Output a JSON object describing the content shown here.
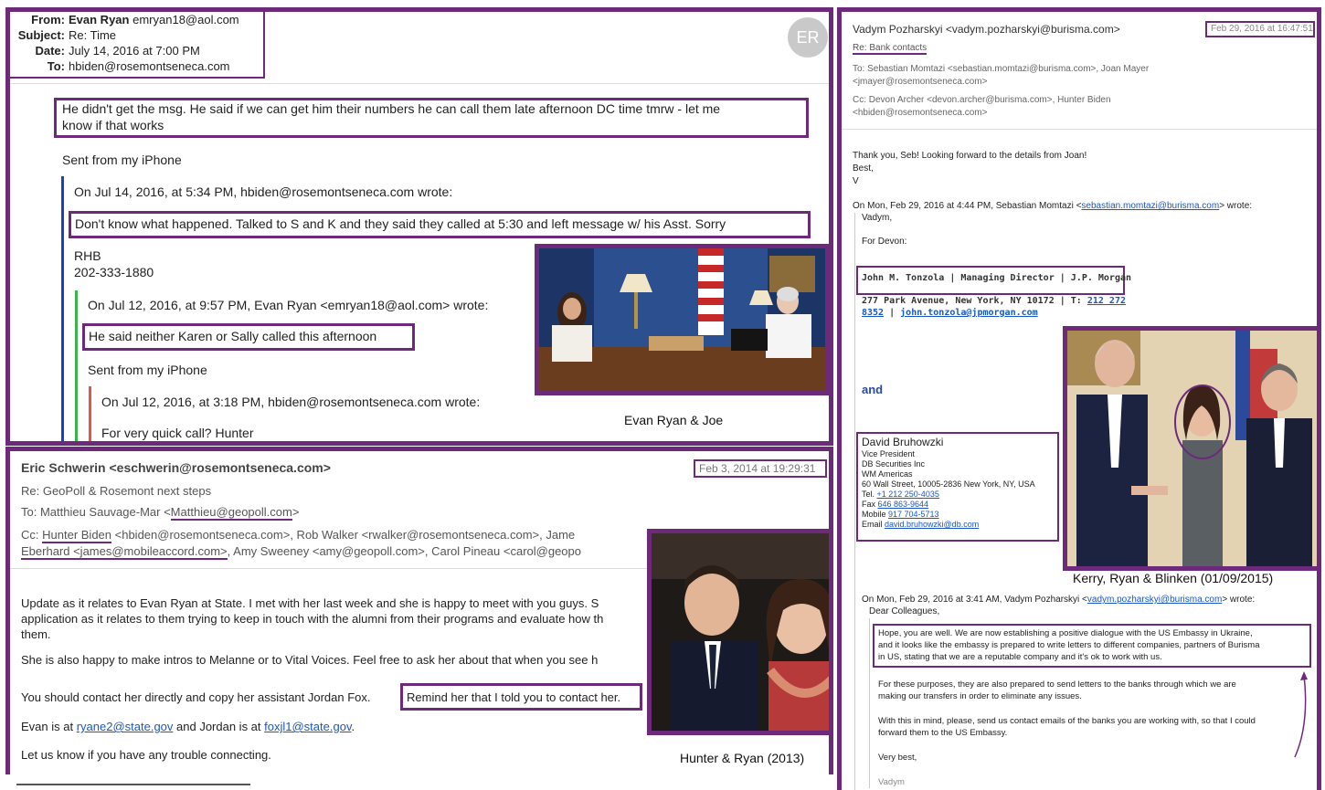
{
  "email1": {
    "header": {
      "from_label": "From:",
      "from_name": "Evan Ryan",
      "from_email": "emryan18@aol.com",
      "subject_label": "Subject:",
      "subject": "Re: Time",
      "date_label": "Date:",
      "date": "July 14, 2016 at 7:00 PM",
      "to_label": "To:",
      "to": "hbiden@rosemontseneca.com",
      "avatar": "ER"
    },
    "msg1": "He didn't get the msg.  He said if we can get him their numbers he can call them late afternoon DC time tmrw - let me",
    "msg1b": "know if that works",
    "sent1": "Sent from my iPhone",
    "quote1_head": "On Jul 14, 2016, at 5:34 PM, hbiden@rosemontseneca.com wrote:",
    "quote1_text": "Don't know what happened. Talked to S and K and they said they called at 5:30 and left message w/ his Asst. Sorry",
    "sig_name": "RHB",
    "sig_phone": "202-333-1880",
    "quote2_head": "On Jul 12, 2016, at 9:57 PM, Evan Ryan <emryan18@aol.com> wrote:",
    "quote2_text": "He said neither Karen or Sally called this afternoon",
    "sent2": "Sent from my iPhone",
    "quote3_head": "On Jul 12, 2016, at 3:18 PM, hbiden@rosemontseneca.com wrote:",
    "quote3_text": "For very quick call? Hunter",
    "photo_caption": "Evan Ryan & Joe"
  },
  "email2": {
    "from": "Eric Schwerin <eschwerin@rosemontseneca.com>",
    "timestamp": "Feb 3, 2014 at 19:29:31",
    "subject": "Re: GeoPoll & Rosemont next steps",
    "to_prefix": "To: Matthieu Sauvage-Mar <",
    "to_email": "Matthieu@geopoll.com",
    "to_suffix": ">",
    "cc_line1_a": "Cc: ",
    "cc_hunter": "Hunter Biden",
    "cc_line1_b": " <hbiden@rosemontseneca.com>, Rob Walker <rwalker@rosemontseneca.com>, Jame",
    "cc_line2_a": "Eberhard <james@mobileaccord.com>",
    "cc_line2_b": ", Amy Sweeney <amy@geopoll.com>, Carol Pineau <carol@geopo",
    "p1a": "Update as it relates to Evan Ryan at State.  I met with her last week and she is happy to meet with you guys.  S",
    "p1b": "application as it relates to them trying to keep in touch with the alumni from their programs and evaluate how th",
    "p1c": "them.",
    "p2": "She is also happy to make intros to Melanne or to Vital Voices.  Feel free to ask her about that when you see h",
    "p3a": "You should contact her directly and copy her assistant Jordan Fox.",
    "p3b": "Remind her that I told you to contact her.",
    "p4_a": "Evan is at ",
    "p4_email1": "ryane2@state.gov",
    "p4_b": " and Jordan is at ",
    "p4_email2": "foxjl1@state.gov",
    "p4_c": ".",
    "p5": "Let us know if you have any trouble connecting.",
    "photo_caption": "Hunter & Ryan (2013)"
  },
  "email3": {
    "from": "Vadym Pozharskyi <vadym.pozharskyi@burisma.com>",
    "timestamp": "Feb 29, 2016 at 16:47:51",
    "subject": "Re: Bank contacts",
    "to_line1": "To: Sebastian Momtazi <sebastian.momtazi@burisma.com>, Joan Mayer",
    "to_line2": "<jmayer@rosemontseneca.com>",
    "cc_line1": "Cc: Devon Archer <devon.archer@burisma.com>, Hunter Biden",
    "cc_line2": "<hbiden@rosemontseneca.com>",
    "thanks": "Thank you, Seb! Looking forward to the details from Joan!",
    "best": "Best,",
    "v": "V",
    "on1_a": "On Mon, Feb 29, 2016 at 4:44 PM, Sebastian Momtazi <",
    "on1_link": "sebastian.momtazi@burisma.com",
    "on1_b": "> wrote:",
    "vadym_salute": "Vadym,",
    "for_devon": "For Devon:",
    "tonzola_line1": "John M. Tonzola | Managing Director | J.P. Morgan",
    "tonzola_line2a": "277 Park Avenue, New York, NY 10172 | T: ",
    "tonzola_phone_a": "212 272",
    "tonzola_phone_b": "8352",
    "tonzola_sep": " | ",
    "tonzola_email": "john.tonzola@jpmorgan.com",
    "and_text": "and",
    "bru_name": "David Bruhowzki",
    "bru_title": "Vice President",
    "bru_company": "DB Securities Inc",
    "bru_div": "WM Americas",
    "bru_addr": "60 Wall Street, 10005-2836 New York, NY, USA",
    "bru_tel_label": "Tel. ",
    "bru_tel": "+1 212 250-4035",
    "bru_fax_label": "Fax ",
    "bru_fax": "646 863-9644",
    "bru_mob_label": "Mobile ",
    "bru_mob": "917 704-5713",
    "bru_email_label": "Email ",
    "bru_email": "david.bruhowzki@db.com",
    "photo_caption": "Kerry, Ryan & Blinken (01/09/2015)",
    "on2_a": "On Mon, Feb 29, 2016 at 3:41 AM, Vadym Pozharskyi <",
    "on2_link": "vadym.pozharskyi@burisma.com",
    "on2_b": "> wrote:",
    "dear": "Dear Colleagues,",
    "hope1": "Hope, you are well. We are now establishing a positive dialogue with the US Embassy in Ukraine,",
    "hope2": "and it looks like the embassy is prepared to write letters to different companies, partners of Burisma",
    "hope3": "in US, stating that we are a reputable company and it's ok to work with us.",
    "purp1": "For these purposes, they are also prepared to send letters to the banks through which we are",
    "purp2": "making our transfers in order to eliminate any issues.",
    "mind1": "With this in  mind, please, send us contact emails of the banks you are working with, so that I could",
    "mind2": "forward them to the US Embassy.",
    "verybest": "Very best,",
    "sign": "Vadym"
  },
  "colors": {
    "accent": "#6e2a7a",
    "link": "#1a57c4"
  }
}
